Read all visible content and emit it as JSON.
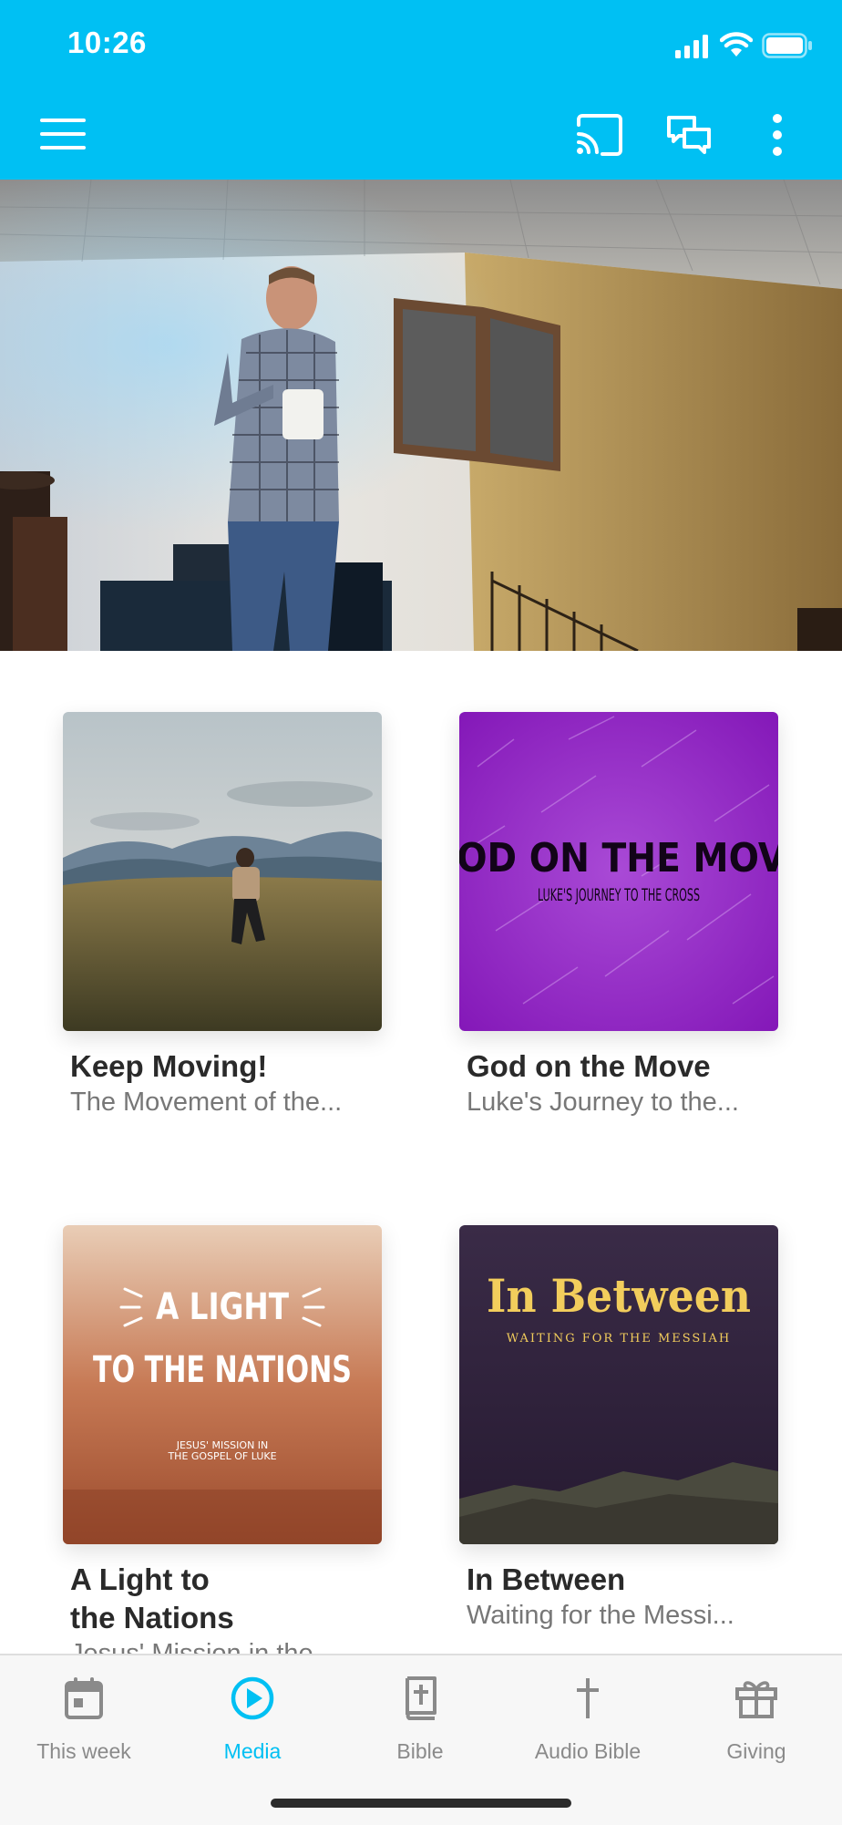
{
  "status_bar": {
    "time": "10:26"
  },
  "cards": [
    {
      "title": "Keep Moving!",
      "subtitle": "The Movement of the..."
    },
    {
      "title": "God on the Move",
      "subtitle": "Luke's Journey to the...",
      "art_title": "GOD ON THE MOVE",
      "art_subtitle": "LUKE'S JOURNEY TO THE CROSS"
    },
    {
      "title_line1": "A Light to",
      "title_line2": "the Nations",
      "subtitle": "Jesus' Mission in the...",
      "art_line1": "A LIGHT",
      "art_line2": "TO THE NATIONS",
      "art_sub1": "JESUS' MISSION IN",
      "art_sub2": "THE GOSPEL OF LUKE"
    },
    {
      "title": "In Between",
      "subtitle": "Waiting for the Messi...",
      "art_title": "In Between",
      "art_subtitle": "WAITING FOR THE MESSIAH"
    }
  ],
  "tabs": [
    {
      "label": "This week",
      "icon": "calendar-icon"
    },
    {
      "label": "Media",
      "icon": "play-circle-icon"
    },
    {
      "label": "Bible",
      "icon": "bible-icon"
    },
    {
      "label": "Audio Bible",
      "icon": "cross-icon"
    },
    {
      "label": "Giving",
      "icon": "gift-icon"
    }
  ],
  "colors": {
    "accent": "#00c0f3",
    "tab_inactive": "#8a8a8a"
  }
}
